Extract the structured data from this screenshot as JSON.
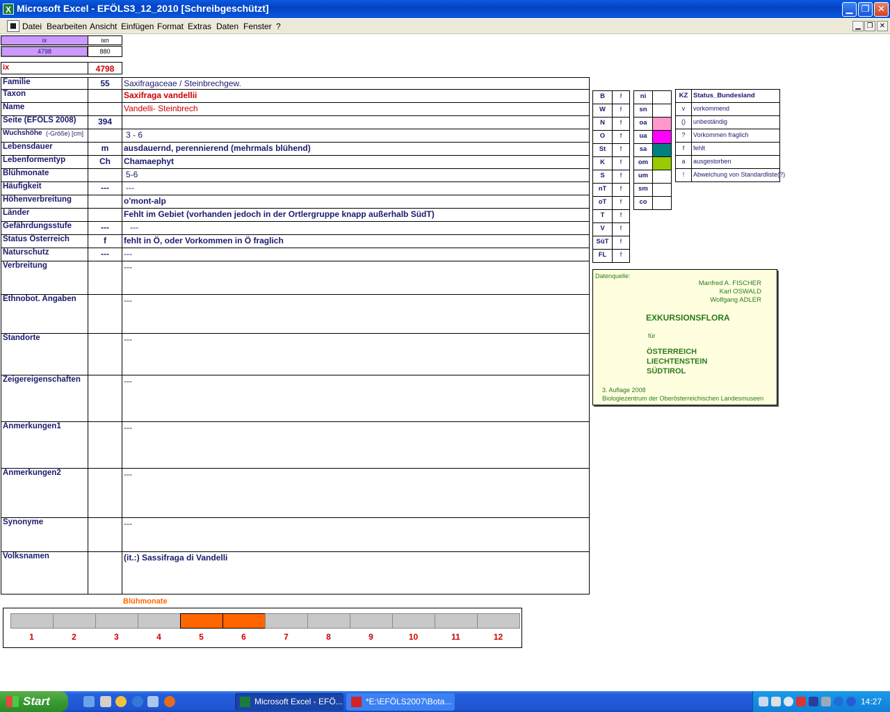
{
  "window": {
    "title": "Microsoft Excel - EFÖLS3_12_2010  [Schreibgeschützt]",
    "app_icon": "excel-icon",
    "minimize": "▁",
    "maximize": "❐",
    "close": "✕"
  },
  "menu": {
    "items": [
      "Datei",
      "Bearbeiten",
      "Ansicht",
      "Einfügen",
      "Format",
      "Extras",
      "Daten",
      "Fenster",
      "?"
    ],
    "doc_minimize": "▁",
    "doc_restore": "❐",
    "doc_close": "✕"
  },
  "index_box": {
    "header_ix": "ix",
    "header_ixn": "ixn",
    "value_ix": "4798",
    "value_ixn": "880",
    "label": "ix",
    "value": "4798"
  },
  "record": {
    "rows": [
      {
        "label": "Familie",
        "code": "55",
        "value": "Saxifragaceae  /  Steinbrechgew."
      },
      {
        "label": "Taxon",
        "code": "",
        "value": "Saxifraga vandellii"
      },
      {
        "label": "Name",
        "code": "",
        "value": "Vandelli- Steinbrech"
      },
      {
        "label": "Seite (EFÖLS 2008)",
        "code": "394",
        "value": ""
      },
      {
        "label": "Wuchshöhe",
        "label_note": "(-Größe) [cm]",
        "code": "",
        "value": "3 - 6"
      },
      {
        "label": "Lebensdauer",
        "code": "m",
        "value": "ausdauernd, perennierend (mehrmals blühend)"
      },
      {
        "label": "Lebenformentyp",
        "code": "Ch",
        "value": "Chamaephyt"
      },
      {
        "label": "Blühmonate",
        "code": "",
        "value": "5-6"
      },
      {
        "label": "Häufigkeit",
        "code": "---",
        "value": "---"
      },
      {
        "label": "Höhenverbreitung",
        "code": "",
        "value": "o'mont-alp"
      },
      {
        "label": "Länder",
        "code": "",
        "value": "Fehlt im Gebiet (vorhanden jedoch in der Ortlergruppe knapp außerhalb SüdT)"
      },
      {
        "label": "Gefährdungsstufe",
        "code": "---",
        "value": "---"
      },
      {
        "label": "Status Österreich",
        "code": "f",
        "value": "fehlt in Ö, oder Vorkommen in Ö fraglich"
      },
      {
        "label": "Naturschutz",
        "code": "---",
        "value": "---"
      },
      {
        "label": "Verbreitung",
        "code": "",
        "value": "---"
      },
      {
        "label": "Ethnobot. Angaben",
        "code": "",
        "value": "---"
      },
      {
        "label": "Standorte",
        "code": "",
        "value": "---"
      },
      {
        "label": "Zeigereigenschaften",
        "code": "",
        "value": "---"
      },
      {
        "label": "Anmerkungen1",
        "code": "",
        "value": "---"
      },
      {
        "label": "Anmerkungen2",
        "code": "",
        "value": "---"
      },
      {
        "label": "Synonyme",
        "code": "",
        "value": "---"
      },
      {
        "label": "Volksnamen",
        "code": "",
        "value": "(it.:) Sassifraga di Vandelli"
      }
    ]
  },
  "bundesland": {
    "codes": [
      "B",
      "W",
      "N",
      "O",
      "St",
      "K",
      "S",
      "nT",
      "oT",
      "T",
      "V",
      "SüT",
      "FL"
    ],
    "status": [
      "f",
      "f",
      "f",
      "f",
      "f",
      "f",
      "f",
      "f",
      "f",
      "f",
      "f",
      "f",
      "f"
    ]
  },
  "regions": {
    "codes": [
      "ni",
      "sn",
      "oa",
      "ua",
      "sa",
      "om",
      "um",
      "sm",
      "co"
    ],
    "colors": [
      "#ffffff",
      "#ffffff",
      "#ff99cc",
      "#ff00ff",
      "#008080",
      "#99cc00",
      "#ffffff",
      "#ffffff",
      "#ffffff"
    ]
  },
  "legend": {
    "header_kz": "KZ",
    "header_status": "Status_Bundesland",
    "items": [
      {
        "kz": "v",
        "text": "vorkommend"
      },
      {
        "kz": "()",
        "text": "unbeständig"
      },
      {
        "kz": "?",
        "text": "Vorkommen fraglich"
      },
      {
        "kz": "f",
        "text": "fehlt"
      },
      {
        "kz": "a",
        "text": "ausgestorben"
      },
      {
        "kz": "!",
        "text": "Abweichung von Standardliste(?)"
      }
    ]
  },
  "source": {
    "label": "Datenquelle:",
    "authors": [
      "Manfred A. FISCHER",
      "Karl OSWALD",
      "Wolfgang ADLER"
    ],
    "title": "EXKURSIONSFLORA",
    "fuer": "für",
    "countries": [
      "ÖSTERREICH",
      "LIECHTENSTEIN",
      "SÜDTIROL"
    ],
    "edition": "3. Auflage 2008",
    "publisher": "Biologiezentrum der Oberösterreichischen Landesmuseen"
  },
  "bloom_chart": {
    "title": "Blühmonate",
    "months": [
      "1",
      "2",
      "3",
      "4",
      "5",
      "6",
      "7",
      "8",
      "9",
      "10",
      "11",
      "12"
    ],
    "active": [
      false,
      false,
      false,
      false,
      true,
      true,
      false,
      false,
      false,
      false,
      false,
      false
    ],
    "active_color": "#ff6600",
    "inactive_color": "#c8c8c8"
  },
  "taskbar": {
    "start": "Start",
    "tasks": [
      "Microsoft Excel - EFÖ...",
      "*E:\\EFÖLS2007\\Bota..."
    ],
    "clock": "14:27"
  }
}
